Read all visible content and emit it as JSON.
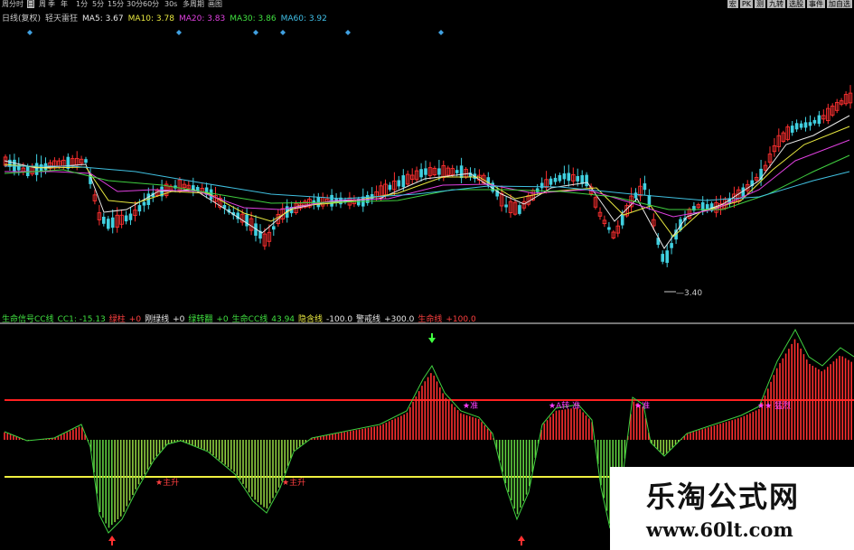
{
  "toolbar": {
    "left_items": [
      "周",
      "分时",
      "日",
      "周",
      "季",
      "年",
      "1分",
      "5分",
      "15分",
      "30分",
      "60分",
      "30s",
      "多周期",
      "画图"
    ],
    "active_index": 2,
    "right_items": [
      "宏",
      "PK",
      "测",
      "九转",
      "选股",
      "事件",
      "加自选"
    ]
  },
  "main_legend": [
    {
      "text": "日线(复权)",
      "color": "#c8c8c8"
    },
    {
      "text": "轻天雷狂",
      "color": "#c8c8c8"
    },
    {
      "text": "MA5: 3.67",
      "color": "#e8e8e8"
    },
    {
      "text": "MA10: 3.78",
      "color": "#e8e840"
    },
    {
      "text": "MA20: 3.83",
      "color": "#e040e0"
    },
    {
      "text": "MA30: 3.86",
      "color": "#40e040"
    },
    {
      "text": "MA60: 3.92",
      "color": "#40c0e8"
    }
  ],
  "ind_legend": [
    {
      "text": "生命信号CC线",
      "color": "#40e040"
    },
    {
      "text": "CC1: -15.13",
      "color": "#40e040"
    },
    {
      "text": "绿柱",
      "color": "#ff4040"
    },
    {
      "text": "+0",
      "color": "#ff4040"
    },
    {
      "text": "刚绿线",
      "color": "#e8e8e8"
    },
    {
      "text": "+0",
      "color": "#e8e8e8"
    },
    {
      "text": "绿转翻",
      "color": "#40e040"
    },
    {
      "text": "+0",
      "color": "#40e040"
    },
    {
      "text": "生命CC线",
      "color": "#40e040"
    },
    {
      "text": "43.94",
      "color": "#40e040"
    },
    {
      "text": "隐含线",
      "color": "#e8e840"
    },
    {
      "text": "-100.0",
      "color": "#e8e8e8"
    },
    {
      "text": "警戒线",
      "color": "#e8e8e8"
    },
    {
      "text": "+300.0",
      "color": "#e8e8e8"
    },
    {
      "text": "生命线",
      "color": "#ff4040"
    },
    {
      "text": "+100.0",
      "color": "#ff4040"
    }
  ],
  "low_label": "3.40",
  "markers": {
    "buy_text": "★主升",
    "s1": "★准",
    "s2": "★A转 准",
    "s3": "★准",
    "s4": "★★ 猛烈"
  },
  "watermark": {
    "line1": "乐淘公式网",
    "line2": "www.60lt.com"
  },
  "chart_data": {
    "type": "candlestick",
    "panels": [
      "price",
      "indicator"
    ],
    "price": {
      "last_low": 3.4,
      "ma": {
        "MA5": 3.67,
        "MA10": 3.78,
        "MA20": 3.83,
        "MA30": 3.86,
        "MA60": 3.92
      }
    },
    "indicator": {
      "CC1": -15.13,
      "life_cc": 43.94,
      "levels": {
        "hidden": -100.0,
        "warning": 300.0,
        "life": 100.0
      }
    },
    "colors": {
      "up": "#ff3030",
      "down": "#40d0e0",
      "red_line": "#ff2020",
      "yellow_line": "#f0f040",
      "cc_line": "#40d040"
    }
  }
}
